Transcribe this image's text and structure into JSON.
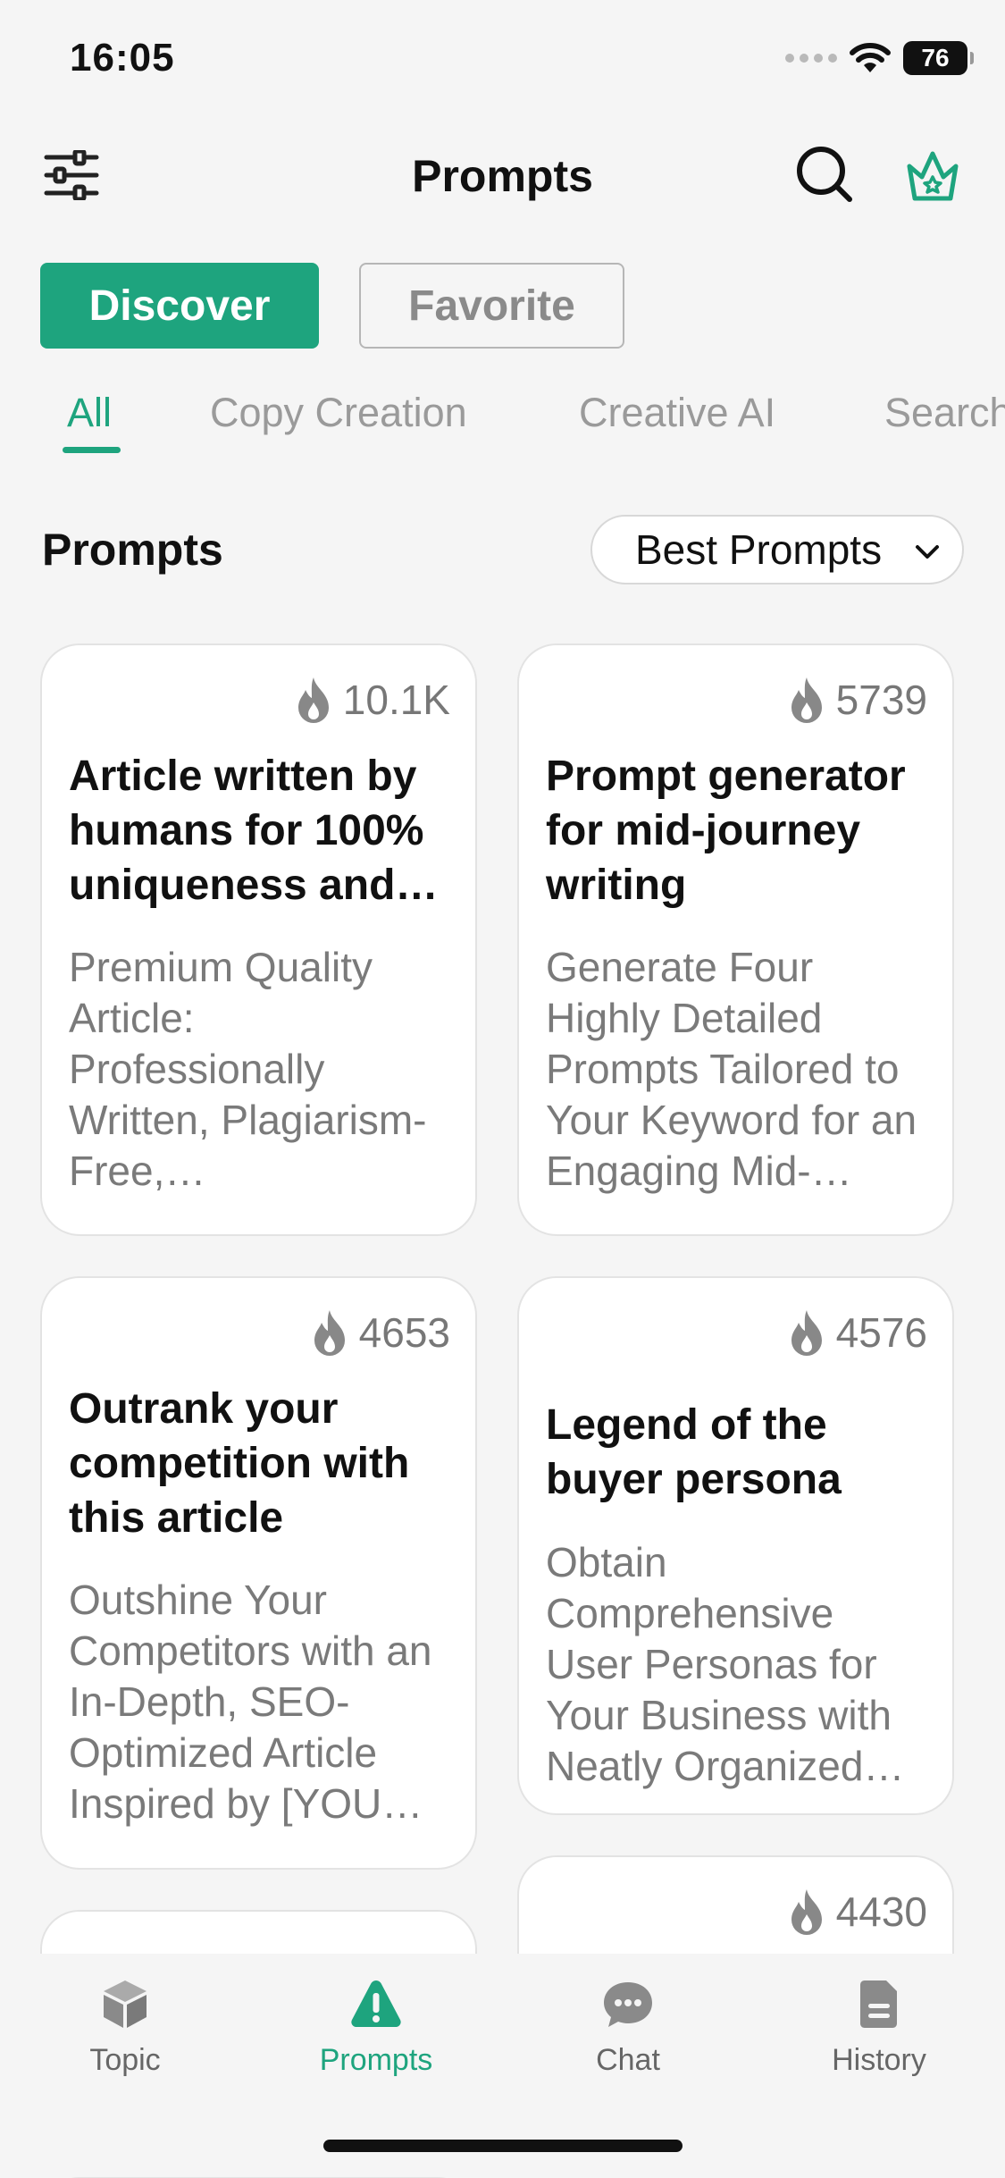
{
  "status": {
    "time": "16:05",
    "battery": "76"
  },
  "header": {
    "title": "Prompts"
  },
  "segments": {
    "discover": "Discover",
    "favorite": "Favorite"
  },
  "categories": [
    "All",
    "Copy Creation",
    "Creative AI",
    "Search"
  ],
  "section": {
    "title": "Prompts",
    "sort": "Best Prompts"
  },
  "cards": [
    {
      "count": "10.1K",
      "title": "Article written by humans for 100% uniqueness and…",
      "desc": "Premium Quality Article: Professionally Written, Plagiarism-Free,…"
    },
    {
      "count": "5739",
      "title": "Prompt generator for mid-journey writing",
      "desc": "Generate Four Highly Detailed Prompts Tailored to Your Keyword for an Engaging Mid-…"
    },
    {
      "count": "4653",
      "title": "Outrank your competition with this article",
      "desc": "Outshine Your Competitors with an In-Depth, SEO-Optimized Article Inspired by [YOU…"
    },
    {
      "count": "4576",
      "title": "Legend of the buyer persona",
      "desc": "Obtain Comprehensive User Personas for Your Business with Neatly Organized…"
    },
    {
      "count": "4430"
    }
  ],
  "tabbar": {
    "topic": "Topic",
    "prompts": "Prompts",
    "chat": "Chat",
    "history": "History"
  },
  "colors": {
    "accent": "#1ea47e",
    "background": "#f5f5f5"
  }
}
